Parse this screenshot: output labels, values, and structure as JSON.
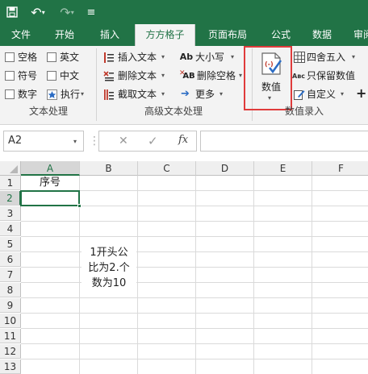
{
  "qat": {
    "save_icon": "save-icon",
    "undo_icon": "undo-icon",
    "undo_glyph": "↶",
    "undo_caret": "▾",
    "redo_icon": "redo-icon",
    "redo_glyph": "↷",
    "redo_caret": "▾",
    "customize_glyph": "≡"
  },
  "tabs": [
    "文件",
    "开始",
    "插入",
    "方方格子",
    "页面布局",
    "公式",
    "数据",
    "审阅"
  ],
  "active_tab": "方方格子",
  "ribbon": {
    "text_processing": {
      "checkboxes": [
        "空格",
        "英文",
        "符号",
        "中文",
        "数字"
      ],
      "exec_label": "执行",
      "group_label": "文本处理"
    },
    "advanced": {
      "insert_text": "插入文本",
      "delete_text": "删除文本",
      "extract_text": "截取文本",
      "case": "大小写",
      "case_icon": "Ab",
      "delete_space": "删除空格",
      "delete_space_icon": "AB",
      "more": "更多",
      "group_label": "高级文本处理"
    },
    "numeric": {
      "value_button": "数值",
      "round": "四舍五入",
      "keep_values": "只保留数值",
      "keep_values_icon": "Aвс",
      "custom": "自定义",
      "group_label": "数值录入",
      "plus": "+"
    },
    "highlight_color": "#e03b3b"
  },
  "formula_bar": {
    "name_box": "A2",
    "cancel": "✕",
    "confirm": "✓",
    "fx": "fx",
    "value": ""
  },
  "sheet": {
    "columns": [
      "A",
      "B",
      "C",
      "D",
      "E",
      "F"
    ],
    "rows": [
      "1",
      "2",
      "3",
      "4",
      "5",
      "6",
      "7",
      "8",
      "9",
      "10",
      "11",
      "12",
      "13"
    ],
    "a1": "序号",
    "annotation_lines": [
      "1开头公",
      "比为2.个",
      "数为10"
    ],
    "selected_cell": "A2"
  },
  "colors": {
    "brand": "#217346",
    "selection": "#217346"
  }
}
